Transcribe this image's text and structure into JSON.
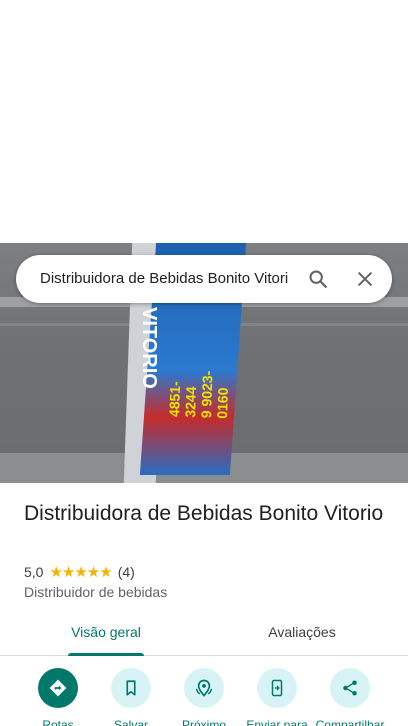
{
  "search": {
    "query": "Distribuidora de Bebidas Bonito Vitorio"
  },
  "photo": {
    "sign_text": "VITORIO",
    "sign_phone_1": "4851-3244",
    "sign_phone_2": "9 9023-0160"
  },
  "place": {
    "name": "Distribuidora de Bebidas Bonito Vitorio",
    "rating": "5,0",
    "stars": "★★★★★",
    "review_count": "(4)",
    "category": "Distribuidor de bebidas"
  },
  "tabs": [
    {
      "label": "Visão geral",
      "selected": true
    },
    {
      "label": "Avaliações",
      "selected": false
    }
  ],
  "actions": [
    {
      "label": "Rotas",
      "icon": "directions-icon"
    },
    {
      "label": "Salvar",
      "icon": "bookmark-icon"
    },
    {
      "label": "Próximo",
      "icon": "nearby-icon"
    },
    {
      "label": "Enviar para",
      "icon": "send-to-phone-icon"
    },
    {
      "label": "Compartilhar",
      "icon": "share-icon"
    }
  ],
  "colors": {
    "accent": "#00796b",
    "action_bg": "#d7f3f6",
    "star": "#f6b400"
  }
}
